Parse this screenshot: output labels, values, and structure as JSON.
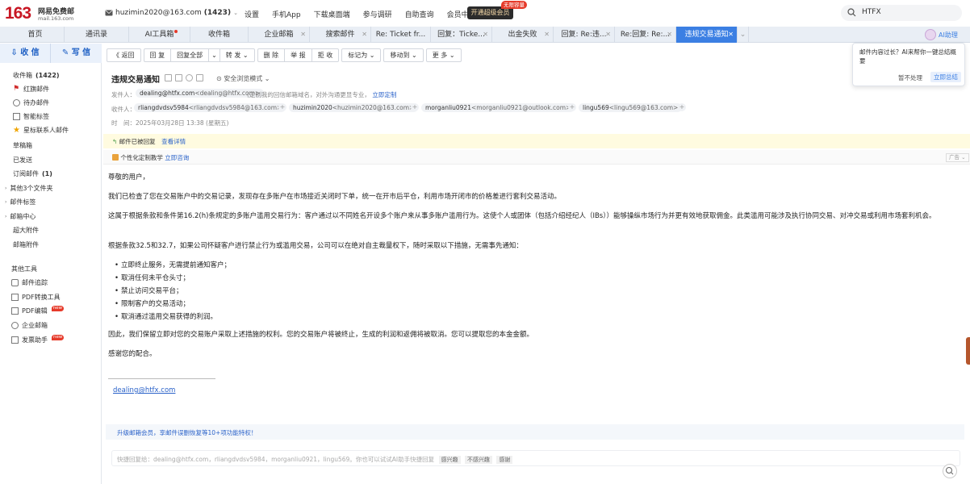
{
  "header": {
    "logo_num": "163",
    "logo_cn": "网易免费邮",
    "logo_domain": "mail.163.com",
    "account": "huzimin2020@163.com",
    "unread": "(1423)",
    "nav": [
      "设置",
      "手机App",
      "下载桌面端",
      "参与调研",
      "自助查询",
      "会员中心"
    ],
    "vip_button": "开通超级会员",
    "vip_badge": "无限容量",
    "search_value": "HTFX"
  },
  "tabs": [
    {
      "label": "首页"
    },
    {
      "label": "通讯录"
    },
    {
      "label": "AI工具箱"
    },
    {
      "label": "收件箱"
    },
    {
      "label": "企业邮箱"
    },
    {
      "label": "搜索邮件"
    },
    {
      "label": "Re: Ticket fr..."
    },
    {
      "label": "回复：Ticke..."
    },
    {
      "label": "出金失败"
    },
    {
      "label": "回复: Re:违..."
    },
    {
      "label": "Re:回复: Re:..."
    },
    {
      "label": "违规交易通知"
    }
  ],
  "ai_assistant": "AI助理",
  "sidebar": {
    "receive": "收 信",
    "write": "写 信",
    "inbox": "收件箱",
    "inbox_count": "(1422)",
    "items": [
      "红旗邮件",
      "待办邮件",
      "智能标签",
      "星标联系人邮件",
      "草稿箱",
      "已发送"
    ],
    "subscription": "订阅邮件",
    "subscription_count": "(1)",
    "groups": [
      "其他3个文件夹",
      "邮件标签",
      "邮箱中心"
    ],
    "extras": [
      "超大附件",
      "邮箱附件"
    ],
    "tools_title": "其他工具",
    "tools": [
      "邮件追踪",
      "PDF转换工具",
      "PDF编辑",
      "企业邮箱",
      "发票助手"
    ],
    "new_badge": "new"
  },
  "toolbar": {
    "back": "《 返回",
    "reply": "回 复",
    "reply_all": "回复全部",
    "forward": "转 发",
    "delete": "删 除",
    "report": "举 报",
    "reject": "拒 收",
    "mark": "标记为",
    "move": "移动到",
    "more": "更 多"
  },
  "ai_popup": {
    "text": "邮件内容过长？AI来帮你一键总结概要",
    "dismiss": "暂不处理",
    "summarize": "立即总结"
  },
  "mail": {
    "subject": "违规交易通知",
    "browse_mode": "安全浏览模式",
    "from_label": "发件人：",
    "from_name": "dealing@htfx.com",
    "from_addr": "<dealing@htfx.com>",
    "from_note": "(定制我的回信邮箱域名，对外沟通更显专业，",
    "from_link": "立即定制",
    "to_label": "收件人：",
    "recipients": [
      {
        "name": "rliangdvdsv5984",
        "addr": "<rliangdvdsv5984@163.com>"
      },
      {
        "name": "huzimin2020",
        "addr": "<huzimin2020@163.com>"
      },
      {
        "name": "morganliu0921",
        "addr": "<morganliu0921@outlook.com>"
      },
      {
        "name": "lingu569",
        "addr": "<lingu569@163.com>"
      }
    ],
    "time_label": "时　间：",
    "time": "2025年03月28日 13:38 (星期五)",
    "replied_notice": "邮件已被回复",
    "replied_link": "查看详情",
    "ad_text": "个性化定制教学",
    "ad_link": "立即咨询",
    "ad_tag": "广告",
    "greeting": "尊敬的用户，",
    "p1": "我们已检查了您在交易账户中的交易记录，发现存在多账户在市场接近关闭时下单，统一在开市后平仓，利用市场开闭市的价格差进行套利交易活动。",
    "p2": "这属于根据条款和条件第16.2(h)条规定的多账户滥用交易行为：客户通过以不同姓名开设多个账户来从事多账户滥用行为。这使个人或团体（包括介绍经纪人（IBs））能够操纵市场行为并更有效地获取佣金。此类滥用可能涉及执行协同交易、对冲交易或利用市场套利机会。",
    "p3": "根据条款32.5和32.7，如果公司怀疑客户进行禁止行为或滥用交易，公司可以在绝对自主裁量权下，随时采取以下措施，无需事先通知：",
    "bullets": [
      "立即终止服务，无需提前通知客户；",
      "取消任何未平仓头寸；",
      "禁止访问交易平台；",
      "限制客户的交易活动；",
      "取消通过滥用交易获得的利润。"
    ],
    "p4": "因此，我们保留立即对您的交易账户采取上述措施的权利。您的交易账户将被终止，生成的利润和返佣将被取消。您可以提取您的本金金额。",
    "p5": "感谢您的配合。",
    "signature": "dealing@htfx.com",
    "upgrade": "升级邮箱会员，享邮件误删恢复等10+项功能特权！",
    "quick_reply": "快捷回复给：dealing@htfx.com，rliangdvdsv5984，morganliu0921，lingu569。你也可以试试AI助手快捷回复",
    "quick_tags": [
      "感兴趣",
      "不感兴趣",
      "感谢"
    ]
  },
  "colors": {
    "brand": "#c81623",
    "accent": "#3b7fe3",
    "notice_bg": "#fffbe0"
  }
}
